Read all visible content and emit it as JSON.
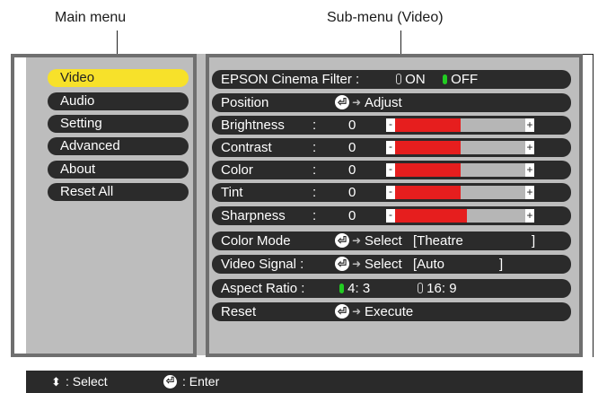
{
  "captions": {
    "main_menu": "Main menu",
    "sub_menu": "Sub-menu (Video)"
  },
  "main_menu": {
    "items": [
      {
        "label": "Video",
        "active": true
      },
      {
        "label": "Audio",
        "active": false
      },
      {
        "label": "Setting",
        "active": false
      },
      {
        "label": "Advanced",
        "active": false
      },
      {
        "label": "About",
        "active": false
      },
      {
        "label": "Reset All",
        "active": false
      }
    ]
  },
  "sub_menu": {
    "cinema_filter": {
      "label": "EPSON Cinema Filter :",
      "on": "ON",
      "off": "OFF",
      "selected": "OFF"
    },
    "position": {
      "label": "Position",
      "action": "Adjust"
    },
    "sliders": [
      {
        "label": "Brightness",
        "value": "0",
        "level": 0.5
      },
      {
        "label": "Contrast",
        "value": "0",
        "level": 0.5
      },
      {
        "label": "Color",
        "value": "0",
        "level": 0.5
      },
      {
        "label": "Tint",
        "value": "0",
        "level": 0.5
      },
      {
        "label": "Sharpness",
        "value": "0",
        "level": 0.55
      }
    ],
    "color_mode": {
      "label": "Color Mode",
      "action": "Select",
      "value": "[Theatre",
      "close": "]"
    },
    "video_signal": {
      "label": "Video Signal :",
      "action": "Select",
      "value": "[Auto",
      "close": "]"
    },
    "aspect_ratio": {
      "label": "Aspect Ratio :",
      "opt1": "4: 3",
      "opt2": "16: 9",
      "selected": "4: 3"
    },
    "reset": {
      "label": "Reset",
      "action": "Execute"
    }
  },
  "footer": {
    "select_label": ": Select",
    "enter_label": ": Enter"
  },
  "colors": {
    "active_item": "#f7e12a",
    "slider_fill": "#e61e1e",
    "radio_on": "#22cc22",
    "panel_bg": "#bdbdbd",
    "row_bg": "#2b2b2b"
  },
  "icons": {
    "enter": "enter-icon",
    "arrow": "right-arrow-icon",
    "updown": "up-down-icon"
  }
}
